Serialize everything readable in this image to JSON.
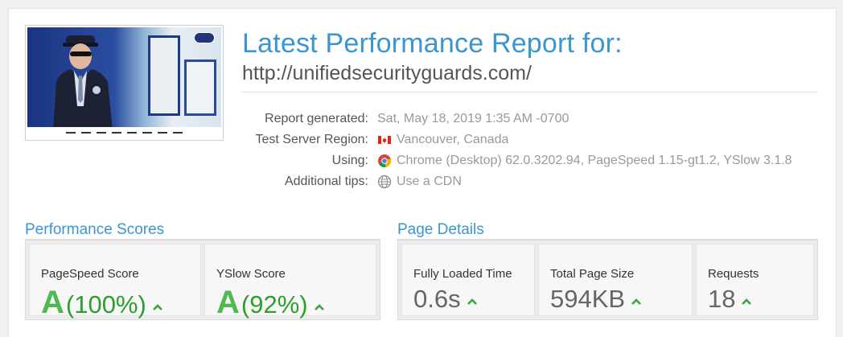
{
  "header": {
    "title": "Latest Performance Report for:",
    "url": "http://unifiedsecurityguards.com/"
  },
  "meta": {
    "rows": [
      {
        "label": "Report generated:",
        "value": "Sat, May 18, 2019 1:35 AM -0700",
        "icon": ""
      },
      {
        "label": "Test Server Region:",
        "value": "Vancouver, Canada",
        "icon": "canada-flag-icon"
      },
      {
        "label": "Using:",
        "value": "Chrome (Desktop) 62.0.3202.94, PageSpeed 1.15-gt1.2, YSlow 3.1.8",
        "icon": "chrome-icon"
      },
      {
        "label": "Additional tips:",
        "value": "Use a CDN",
        "icon": "globe-icon"
      }
    ]
  },
  "performance": {
    "title": "Performance Scores",
    "pagespeed": {
      "label": "PageSpeed Score",
      "grade": "A",
      "percent": "(100%)"
    },
    "yslow": {
      "label": "YSlow Score",
      "grade": "A",
      "percent": "(92%)"
    }
  },
  "details": {
    "title": "Page Details",
    "loaded": {
      "label": "Fully Loaded Time",
      "value": "0.6s"
    },
    "size": {
      "label": "Total Page Size",
      "value": "594KB"
    },
    "requests": {
      "label": "Requests",
      "value": "18"
    }
  },
  "colors": {
    "accent": "#3a95d1",
    "grade_green": "#4fb84f",
    "trend_green": "#3aa63a"
  }
}
